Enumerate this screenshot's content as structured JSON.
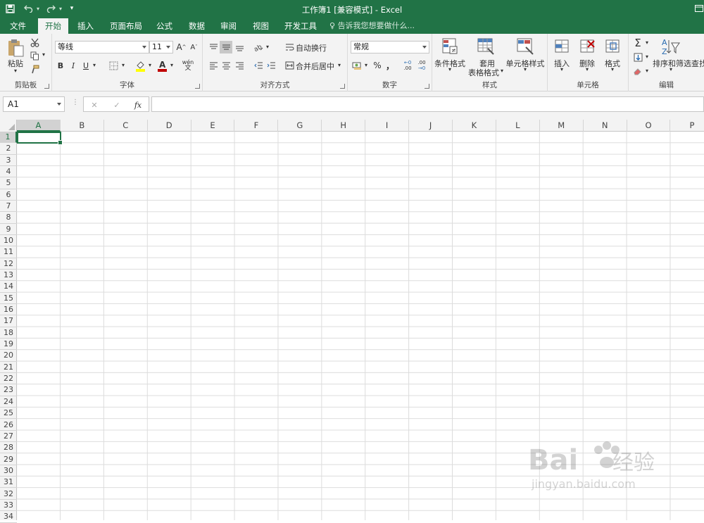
{
  "titlebar": {
    "title": "工作簿1  [兼容模式] - Excel",
    "save_icon": "save-icon",
    "undo_icon": "undo-icon",
    "redo_icon": "redo-icon",
    "customize_icon": "customize-icon"
  },
  "tabs": [
    "文件",
    "开始",
    "插入",
    "页面布局",
    "公式",
    "数据",
    "审阅",
    "视图",
    "开发工具"
  ],
  "active_tab": "开始",
  "tell_me": "告诉我您想要做什么...",
  "ribbon": {
    "clipboard": {
      "label": "剪贴板",
      "paste": "粘贴"
    },
    "font": {
      "label": "字体",
      "name": "等线",
      "size": "11",
      "bold": "B",
      "italic": "I",
      "underline": "U",
      "wen": "wén",
      "grow": "A",
      "shrink": "A"
    },
    "alignment": {
      "label": "对齐方式",
      "wrap": "自动换行",
      "merge": "合并后居中"
    },
    "number": {
      "label": "数字",
      "format": "常规",
      "percent": "%",
      "comma": "，",
      "inc": ".00",
      "dec": ".00"
    },
    "styles": {
      "label": "样式",
      "conditional": "条件格式",
      "table_line1": "套用",
      "table_line2": "表格格式",
      "cell_styles": "单元格样式"
    },
    "cells": {
      "label": "单元格",
      "insert": "插入",
      "delete": "删除",
      "format": "格式"
    },
    "editing": {
      "label": "编辑",
      "sort": "排序和筛选",
      "find": "查找"
    }
  },
  "formula_bar": {
    "name_box": "A1",
    "cancel": "✕",
    "enter": "✓",
    "fx": "fx",
    "content": ""
  },
  "columns": [
    "A",
    "B",
    "C",
    "D",
    "E",
    "F",
    "G",
    "H",
    "I",
    "J",
    "K",
    "L",
    "M",
    "N",
    "O",
    "P"
  ],
  "rows": [
    "1",
    "2",
    "3",
    "4",
    "5",
    "6",
    "7",
    "8",
    "9",
    "10",
    "11",
    "12",
    "13",
    "14",
    "15",
    "16",
    "17",
    "18",
    "19",
    "20",
    "21",
    "22",
    "23",
    "24",
    "25",
    "26",
    "27",
    "28",
    "29",
    "30",
    "31",
    "32",
    "33",
    "34"
  ],
  "watermark": "Baidu经验 jingyan.baidu.com",
  "colors": {
    "accent": "#217346",
    "font_red": "#c00000",
    "highlight_yellow": "#ffff00"
  }
}
